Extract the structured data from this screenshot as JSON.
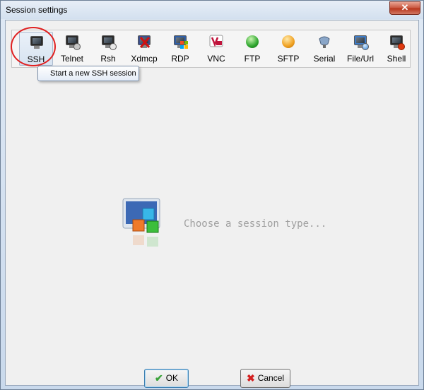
{
  "window": {
    "title": "Session settings",
    "close_glyph": "✕"
  },
  "toolbar": {
    "items": [
      {
        "label": "SSH",
        "icon": "ssh-terminal-icon",
        "selected": true
      },
      {
        "label": "Telnet",
        "icon": "telnet-terminal-icon"
      },
      {
        "label": "Rsh",
        "icon": "rsh-terminal-icon"
      },
      {
        "label": "Xdmcp",
        "icon": "xdmcp-icon"
      },
      {
        "label": "RDP",
        "icon": "rdp-icon"
      },
      {
        "label": "VNC",
        "icon": "vnc-icon"
      },
      {
        "label": "FTP",
        "icon": "ftp-icon"
      },
      {
        "label": "SFTP",
        "icon": "sftp-icon"
      },
      {
        "label": "Serial",
        "icon": "serial-icon"
      },
      {
        "label": "File/Url",
        "icon": "file-url-icon"
      },
      {
        "label": "Shell",
        "icon": "shell-icon"
      }
    ]
  },
  "tooltip": {
    "text": "Start a new SSH session"
  },
  "main": {
    "placeholder": "Choose a session type..."
  },
  "buttons": {
    "ok": "OK",
    "cancel": "Cancel"
  },
  "colors": {
    "highlight_circle": "#e02020",
    "ok_check": "#3aa33a",
    "cancel_x": "#d42020"
  }
}
